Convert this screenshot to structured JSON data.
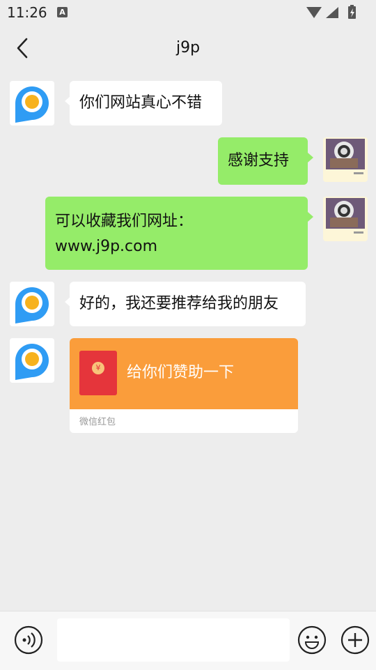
{
  "status_bar": {
    "time": "11:26",
    "badge": "A"
  },
  "header": {
    "title": "j9p"
  },
  "messages": [
    {
      "side": "left",
      "text": "你们网站真心不错"
    },
    {
      "side": "right",
      "text": "感谢支持"
    },
    {
      "side": "right",
      "line1": "可以收藏我们网址：",
      "line2": "www.j9p.com"
    },
    {
      "side": "left",
      "text": "好的，我还要推荐给我的朋友"
    }
  ],
  "red_packet": {
    "coin": "¥",
    "title": "给你们赞助一下",
    "footer": "微信红包"
  },
  "colors": {
    "accent_orange": "#fa9d3b",
    "bubble_green": "#95ec69",
    "avatar_blue": "#2f9cf4",
    "avatar_yellow": "#f7b21e"
  },
  "icons": [
    "back-arrow-icon",
    "wifi-icon",
    "battery-icon",
    "voice-icon",
    "emoji-icon",
    "plus-icon"
  ]
}
